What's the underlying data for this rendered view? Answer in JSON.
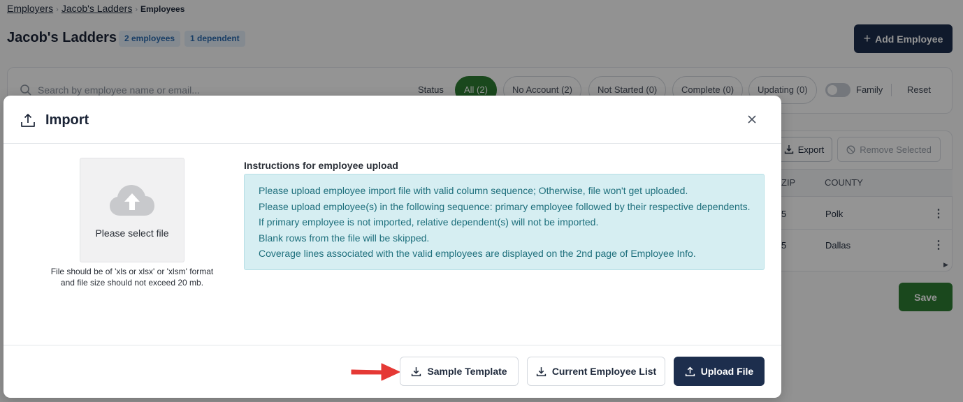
{
  "breadcrumb": {
    "items": [
      "Employers",
      "Jacob's Ladders"
    ],
    "current": "Employees"
  },
  "header": {
    "title": "Jacob's Ladders",
    "employees_badge": "2 employees",
    "dependents_badge": "1 dependent",
    "add_button": "Add Employee"
  },
  "filters": {
    "search_placeholder": "Search by employee name or email...",
    "status_label": "Status",
    "chips": [
      "All (2)",
      "No Account (2)",
      "Not Started (0)",
      "Complete (0)",
      "Updating (0)"
    ],
    "active_chip": "All (2)",
    "family_label": "Family",
    "family_toggle": "off",
    "reset_label": "Reset"
  },
  "table": {
    "export_label": "Export",
    "remove_selected_label": "Remove Selected",
    "columns": [
      "ZIP",
      "COUNTY"
    ],
    "rows": [
      {
        "zip": "5",
        "county": "Polk"
      },
      {
        "zip": "5",
        "county": "Dallas"
      }
    ]
  },
  "save_label": "Save",
  "modal": {
    "title": "Import",
    "dropzone_label": "Please select file",
    "file_note_line1": "File should be of 'xls or xlsx' or 'xlsm' format",
    "file_note_line2": "and file size should not exceed 20 mb.",
    "instructions_title": "Instructions for employee upload",
    "instructions": [
      "Please upload employee import file with valid column sequence; Otherwise, file won't get uploaded.",
      "Please upload employee(s) in the following sequence: primary employee followed by their respective dependents.",
      "If primary employee is not imported, relative dependent(s) will not be imported.",
      "Blank rows from the file will be skipped.",
      "Coverage lines associated with the valid employees are displayed on the 2nd page of Employee Info."
    ],
    "buttons": {
      "sample_template": "Sample Template",
      "current_list": "Current Employee List",
      "upload": "Upload File"
    }
  },
  "colors": {
    "navy": "#1d2e4d",
    "green": "#2e7d32",
    "info_bg": "#d6eef2",
    "info_text": "#1e6f7c",
    "arrow": "#e53935"
  },
  "icons": [
    "search-icon",
    "plus-icon",
    "upload-icon",
    "close-icon",
    "cloud-upload-icon",
    "download-icon",
    "block-icon",
    "kebab-icon",
    "arrow-pointer-icon"
  ]
}
